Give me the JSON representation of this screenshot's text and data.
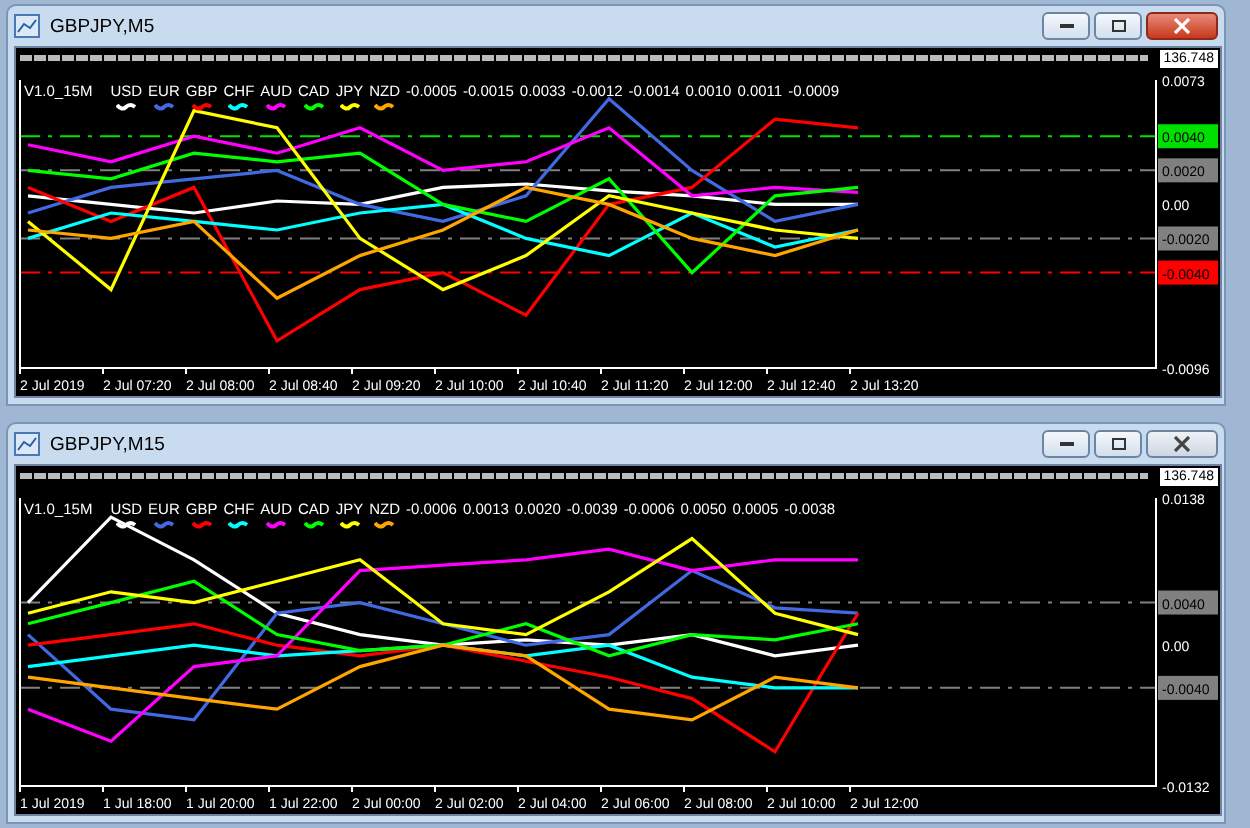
{
  "windows": [
    {
      "title": "GBPJPY,M5",
      "active": true,
      "price_label": "136.748",
      "legend": {
        "indicator": "V1.0_15M",
        "values": [
          "-0.0005",
          "-0.0015",
          "0.0033",
          "-0.0012",
          "-0.0014",
          "0.0010",
          "0.0011",
          "-0.0009"
        ]
      },
      "chart_data": {
        "type": "line",
        "categories": [
          "2 Jul 2019",
          "2 Jul 07:20",
          "2 Jul 08:00",
          "2 Jul 08:40",
          "2 Jul 09:20",
          "2 Jul 10:00",
          "2 Jul 10:40",
          "2 Jul 11:20",
          "2 Jul 12:00",
          "2 Jul 12:40",
          "2 Jul 13:20"
        ],
        "ylim": [
          -0.0096,
          0.0073
        ],
        "yticks": [
          {
            "value": 0.0073,
            "label": "0.0073"
          },
          {
            "value": 0.004,
            "label": "0.0040"
          },
          {
            "value": 0.002,
            "label": "0.0020"
          },
          {
            "value": 0,
            "label": "0.00"
          },
          {
            "value": -0.002,
            "label": "-0.0020"
          },
          {
            "value": -0.004,
            "label": "-0.0040"
          },
          {
            "value": -0.0096,
            "label": "-0.0096"
          }
        ],
        "ref_lines": [
          {
            "axis": "y",
            "value": 0.004,
            "color": "#00e000"
          },
          {
            "axis": "y",
            "value": 0.002,
            "color": "#808080"
          },
          {
            "axis": "y",
            "value": -0.002,
            "color": "#808080"
          },
          {
            "axis": "y",
            "value": -0.004,
            "color": "#ff0000"
          }
        ],
        "series": [
          {
            "name": "USD",
            "color": "#ffffff",
            "values": [
              0.0005,
              0.0,
              -0.0005,
              0.0002,
              0.0,
              0.001,
              0.0012,
              0.0008,
              0.0005,
              0.0,
              0.0
            ]
          },
          {
            "name": "EUR",
            "color": "#4169e1",
            "values": [
              -0.0005,
              0.001,
              0.0015,
              0.002,
              0.0,
              -0.001,
              0.0005,
              0.0062,
              0.002,
              -0.001,
              0.0
            ]
          },
          {
            "name": "GBP",
            "color": "#ff0000",
            "values": [
              0.001,
              -0.001,
              0.001,
              -0.008,
              -0.005,
              -0.004,
              -0.0065,
              0.0,
              0.001,
              0.005,
              0.0045
            ]
          },
          {
            "name": "CHF",
            "color": "#00ffff",
            "values": [
              -0.002,
              -0.0005,
              -0.001,
              -0.0015,
              -0.0005,
              0.0,
              -0.002,
              -0.003,
              -0.0005,
              -0.0025,
              -0.0015
            ]
          },
          {
            "name": "AUD",
            "color": "#ff00ff",
            "values": [
              0.0035,
              0.0025,
              0.004,
              0.003,
              0.0045,
              0.002,
              0.0025,
              0.0045,
              0.0005,
              0.001,
              0.0007
            ]
          },
          {
            "name": "CAD",
            "color": "#00ff00",
            "values": [
              0.002,
              0.0015,
              0.003,
              0.0025,
              0.003,
              0.0,
              -0.001,
              0.0015,
              -0.004,
              0.0005,
              0.001
            ]
          },
          {
            "name": "JPY",
            "color": "#ffff00",
            "values": [
              -0.001,
              -0.005,
              0.0055,
              0.0045,
              -0.002,
              -0.005,
              -0.003,
              0.0005,
              -0.0005,
              -0.0015,
              -0.002
            ]
          },
          {
            "name": "NZD",
            "color": "#ffa500",
            "values": [
              -0.0015,
              -0.002,
              -0.001,
              -0.0055,
              -0.003,
              -0.0015,
              0.001,
              0.0,
              -0.002,
              -0.003,
              -0.0015
            ]
          }
        ]
      }
    },
    {
      "title": "GBPJPY,M15",
      "active": false,
      "price_label": "136.748",
      "legend": {
        "indicator": "V1.0_15M",
        "values": [
          "-0.0006",
          "0.0013",
          "0.0020",
          "-0.0039",
          "-0.0006",
          "0.0050",
          "0.0005",
          "-0.0038"
        ]
      },
      "chart_data": {
        "type": "line",
        "categories": [
          "1 Jul 2019",
          "1 Jul 18:00",
          "1 Jul 20:00",
          "1 Jul 22:00",
          "2 Jul 00:00",
          "2 Jul 02:00",
          "2 Jul 04:00",
          "2 Jul 06:00",
          "2 Jul 08:00",
          "2 Jul 10:00",
          "2 Jul 12:00"
        ],
        "ylim": [
          -0.0132,
          0.0138
        ],
        "yticks": [
          {
            "value": 0.0138,
            "label": "0.0138"
          },
          {
            "value": 0.004,
            "label": "0.0040"
          },
          {
            "value": 0,
            "label": "0.00"
          },
          {
            "value": -0.004,
            "label": "-0.0040"
          },
          {
            "value": -0.0132,
            "label": "-0.0132"
          }
        ],
        "ref_lines": [
          {
            "axis": "y",
            "value": 0.004,
            "color": "#808080"
          },
          {
            "axis": "y",
            "value": -0.004,
            "color": "#808080"
          }
        ],
        "series": [
          {
            "name": "USD",
            "color": "#ffffff",
            "values": [
              0.004,
              0.012,
              0.008,
              0.003,
              0.001,
              0.0,
              0.0005,
              0.0,
              0.001,
              -0.001,
              0.0
            ]
          },
          {
            "name": "EUR",
            "color": "#4169e1",
            "values": [
              0.001,
              -0.006,
              -0.007,
              0.003,
              0.004,
              0.002,
              0.0,
              0.001,
              0.007,
              0.0035,
              0.003
            ]
          },
          {
            "name": "GBP",
            "color": "#ff0000",
            "values": [
              0.0,
              0.001,
              0.002,
              0.0,
              -0.001,
              0.0,
              -0.0015,
              -0.003,
              -0.005,
              -0.01,
              0.003
            ]
          },
          {
            "name": "CHF",
            "color": "#00ffff",
            "values": [
              -0.002,
              -0.001,
              0.0,
              -0.001,
              -0.0005,
              0.0,
              -0.001,
              0.0,
              -0.003,
              -0.004,
              -0.004
            ]
          },
          {
            "name": "AUD",
            "color": "#ff00ff",
            "values": [
              -0.006,
              -0.009,
              -0.002,
              -0.001,
              0.007,
              0.0075,
              0.008,
              0.009,
              0.007,
              0.008,
              0.008
            ]
          },
          {
            "name": "CAD",
            "color": "#00ff00",
            "values": [
              0.002,
              0.004,
              0.006,
              0.001,
              -0.0005,
              0.0,
              0.002,
              -0.001,
              0.001,
              0.0005,
              0.002
            ]
          },
          {
            "name": "JPY",
            "color": "#ffff00",
            "values": [
              0.003,
              0.005,
              0.004,
              0.006,
              0.008,
              0.002,
              0.001,
              0.005,
              0.01,
              0.003,
              0.001
            ]
          },
          {
            "name": "NZD",
            "color": "#ffa500",
            "values": [
              -0.003,
              -0.004,
              -0.005,
              -0.006,
              -0.002,
              0.0,
              -0.001,
              -0.006,
              -0.007,
              -0.003,
              -0.004
            ]
          }
        ]
      }
    }
  ]
}
